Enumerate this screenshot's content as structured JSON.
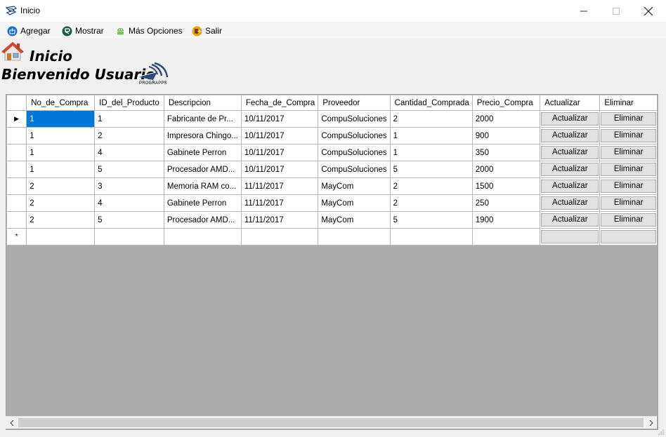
{
  "window": {
    "title": "Inicio",
    "controls": {
      "minimize": "—",
      "maximize": "☐",
      "close": "✕"
    }
  },
  "menu": {
    "items": [
      {
        "label": "Agregar",
        "icon": "add-icon",
        "color": "#1e6fc8"
      },
      {
        "label": "Mostrar",
        "icon": "show-icon",
        "color": "#1f5a45"
      },
      {
        "label": "Más Opciones",
        "icon": "android-icon",
        "color": "#78c257"
      },
      {
        "label": "Salir",
        "icon": "exit-icon",
        "color": "#e8a418"
      }
    ]
  },
  "heading": {
    "title": "Inicio",
    "welcome": "Bienvenido Usuario",
    "logo_text": "PROGRAPPS"
  },
  "grid": {
    "columns": [
      "No_de_Compra",
      "ID_del_Producto",
      "Descripcion",
      "Fecha_de_Compra",
      "Proveedor",
      "Cantidad_Comprada",
      "Precio_Compra",
      "Actualizar",
      "Eliminar"
    ],
    "button_labels": {
      "update": "Actualizar",
      "delete": "Eliminar"
    },
    "current_row_marker": "▶",
    "new_row_marker": "*",
    "rows": [
      [
        "1",
        "1",
        "Fabricante de Pr...",
        "10/11/2017",
        "CompuSoluciones",
        "2",
        "2000"
      ],
      [
        "1",
        "2",
        "Impresora Chingo...",
        "10/11/2017",
        "CompuSoluciones",
        "1",
        "900"
      ],
      [
        "1",
        "4",
        "Gabinete Perron",
        "10/11/2017",
        "CompuSoluciones",
        "1",
        "350"
      ],
      [
        "1",
        "5",
        "Procesador AMD...",
        "10/11/2017",
        "CompuSoluciones",
        "5",
        "2000"
      ],
      [
        "2",
        "3",
        "Memoria RAM co...",
        "11/11/2017",
        "MayCom",
        "2",
        "1500"
      ],
      [
        "2",
        "4",
        "Gabinete Perron",
        "11/11/2017",
        "MayCom",
        "2",
        "250"
      ],
      [
        "2",
        "5",
        "Procesador AMD...",
        "11/11/2017",
        "MayCom",
        "5",
        "1900"
      ]
    ]
  },
  "colors": {
    "selection": "#0078d7",
    "grid_background": "#ababab"
  }
}
